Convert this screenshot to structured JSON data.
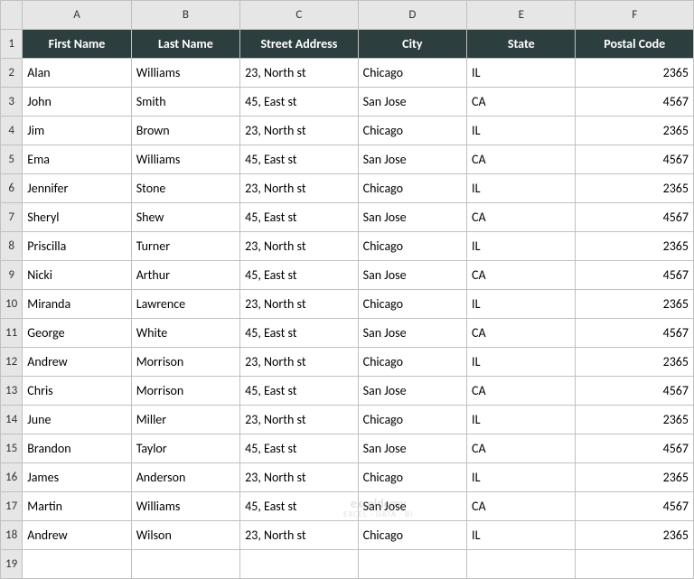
{
  "columns": [
    "A",
    "B",
    "C",
    "D",
    "E",
    "F"
  ],
  "headers": [
    "First Name",
    "Last Name",
    "Street Address",
    "City",
    "State",
    "Postal Code"
  ],
  "rows": [
    [
      "Alan",
      "Williams",
      "23, North st",
      "Chicago",
      "IL",
      "2365"
    ],
    [
      "John",
      "Smith",
      "45, East st",
      "San Jose",
      "CA",
      "4567"
    ],
    [
      "Jim",
      "Brown",
      "23, North st",
      "Chicago",
      "IL",
      "2365"
    ],
    [
      "Ema",
      "Williams",
      "45, East st",
      "San Jose",
      "CA",
      "4567"
    ],
    [
      "Jennifer",
      "Stone",
      "23, North st",
      "Chicago",
      "IL",
      "2365"
    ],
    [
      "Sheryl",
      "Shew",
      "45, East st",
      "San Jose",
      "CA",
      "4567"
    ],
    [
      "Priscilla",
      "Turner",
      "23, North st",
      "Chicago",
      "IL",
      "2365"
    ],
    [
      "Nicki",
      "Arthur",
      "45, East st",
      "San Jose",
      "CA",
      "4567"
    ],
    [
      "Miranda",
      "Lawrence",
      "23, North st",
      "Chicago",
      "IL",
      "2365"
    ],
    [
      "George",
      "White",
      "45, East st",
      "San Jose",
      "CA",
      "4567"
    ],
    [
      "Andrew",
      "Morrison",
      "23, North st",
      "Chicago",
      "IL",
      "2365"
    ],
    [
      "Chris",
      "Morrison",
      "45, East st",
      "San Jose",
      "CA",
      "4567"
    ],
    [
      "June",
      "Miller",
      "23, North st",
      "Chicago",
      "IL",
      "2365"
    ],
    [
      "Brandon",
      "Taylor",
      "45, East st",
      "San Jose",
      "CA",
      "4567"
    ],
    [
      "James",
      "Anderson",
      "23, North st",
      "Chicago",
      "IL",
      "2365"
    ],
    [
      "Martin",
      "Williams",
      "45, East st",
      "San Jose",
      "CA",
      "4567"
    ],
    [
      "Andrew",
      "Wilson",
      "23, North st",
      "Chicago",
      "IL",
      "2365"
    ]
  ],
  "emptyRow": 19,
  "watermark": {
    "main": "exceldemy",
    "sub": "EXCEL · DATA · BI"
  }
}
